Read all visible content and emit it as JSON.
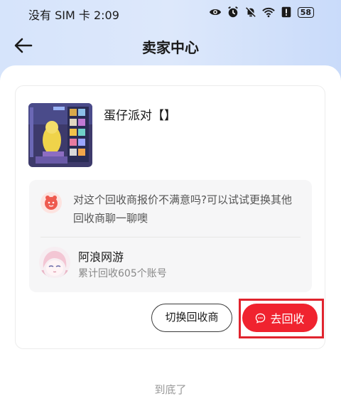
{
  "status_bar": {
    "left_text": "没有 SIM 卡 2:09",
    "battery": "58",
    "icons": [
      "eye-icon",
      "alarm-icon",
      "mute-bell-icon",
      "wifi-icon",
      "alert-icon",
      "battery-icon"
    ]
  },
  "nav": {
    "title": "卖家中心",
    "back_icon": "arrow-left-icon"
  },
  "product": {
    "title": "蛋仔派对【】",
    "thumbnail": "game-screenshot"
  },
  "tip": {
    "text": "对这个回收商报价不满意吗?可以试试更换其他回收商聊一聊噢",
    "icon": "mascot-icon"
  },
  "recycler": {
    "name": "阿浪网游",
    "stats": "累计回收605个账号"
  },
  "actions": {
    "switch_label": "切换回收商",
    "go_label": "去回收",
    "go_icon": "chat-bubble-icon"
  },
  "footer": {
    "end_text": "到底了"
  },
  "colors": {
    "accent": "#f0232f",
    "header_bg": "#d6e4fb",
    "highlight_border": "#e0242e"
  }
}
